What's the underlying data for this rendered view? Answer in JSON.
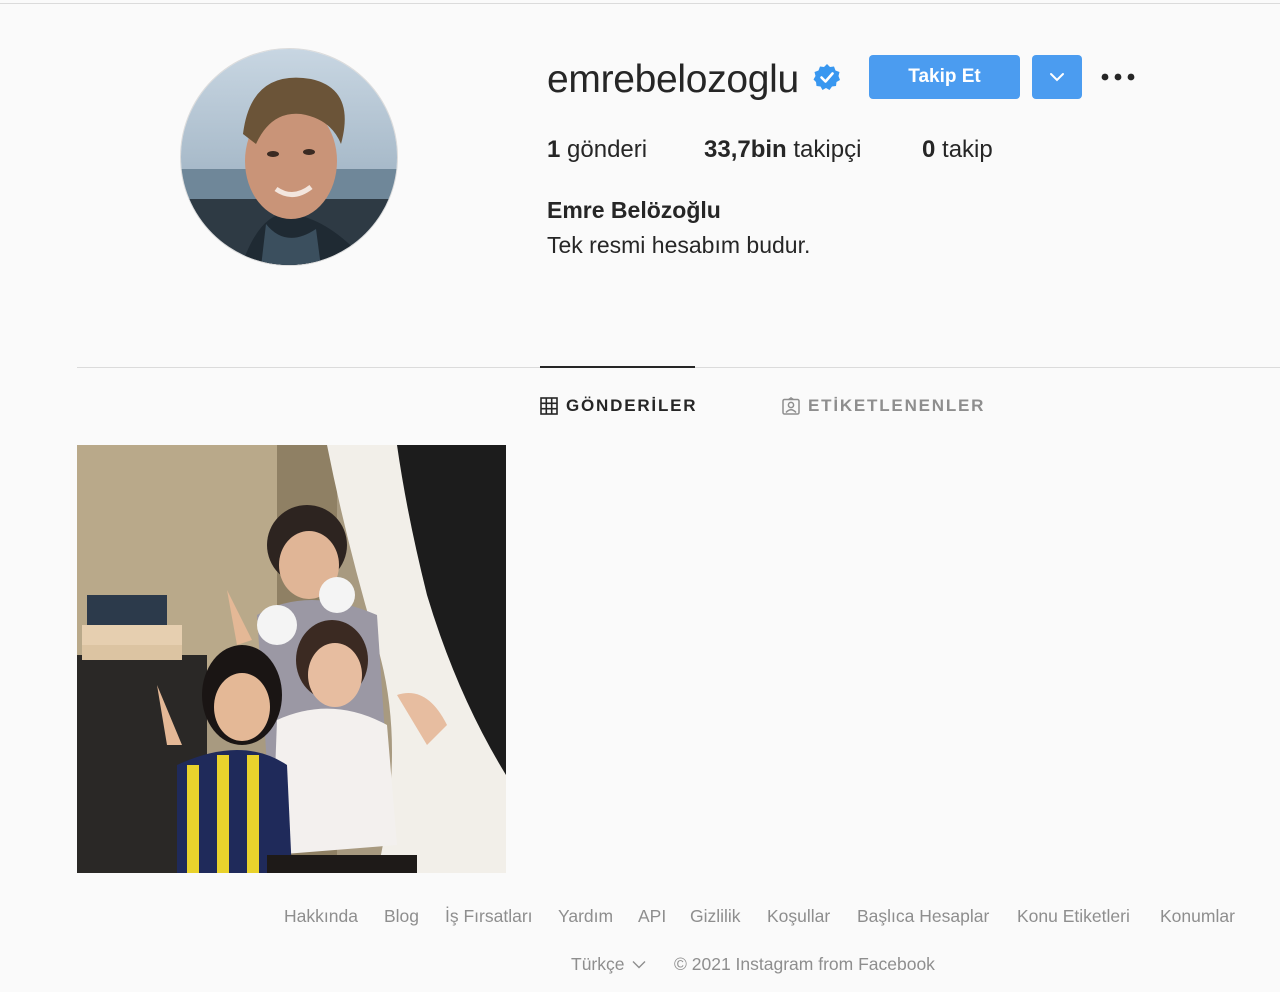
{
  "profile": {
    "username": "emrebelozoglu",
    "verified_icon": "verified-badge-icon",
    "follow_label": "Takip Et",
    "posts_count": "1",
    "posts_label": "gönderi",
    "followers_count": "33,7bin",
    "followers_label": "takipçi",
    "following_count": "0",
    "following_label": "takip",
    "full_name": "Emre Belözoğlu",
    "bio": "Tek resmi hesabım budur."
  },
  "tabs": [
    {
      "label": "GÖNDERİLER",
      "icon": "grid-icon",
      "active": true
    },
    {
      "label": "ETİKETLENENLER",
      "icon": "tagged-icon",
      "active": false
    }
  ],
  "footer": {
    "links": [
      "Hakkında",
      "Blog",
      "İş Fırsatları",
      "Yardım",
      "API",
      "Gizlilik",
      "Koşullar",
      "Başlıca Hesaplar",
      "Konu Etiketleri",
      "Konumlar"
    ],
    "language": "Türkçe",
    "copyright": "© 2021 Instagram from Facebook"
  },
  "colors": {
    "accent": "#4b9cf0",
    "background": "#fafafa",
    "text": "#262626",
    "muted": "#8e8e8e"
  }
}
